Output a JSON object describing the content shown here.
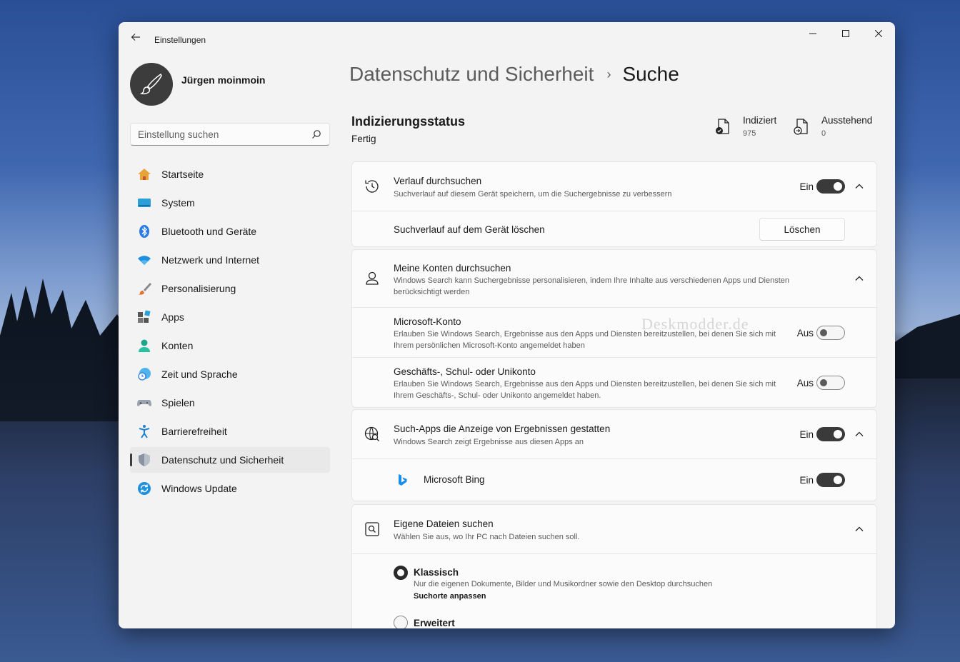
{
  "window": {
    "title": "Einstellungen",
    "controls": {
      "minimize": "—",
      "maximize": "☐",
      "close": "✕"
    }
  },
  "user": {
    "name": "Jürgen moinmoin"
  },
  "search": {
    "placeholder": "Einstellung suchen"
  },
  "sidebar": {
    "items": [
      {
        "label": "Startseite",
        "icon": "home-icon"
      },
      {
        "label": "System",
        "icon": "system-icon"
      },
      {
        "label": "Bluetooth und Geräte",
        "icon": "bluetooth-icon"
      },
      {
        "label": "Netzwerk und Internet",
        "icon": "wifi-icon"
      },
      {
        "label": "Personalisierung",
        "icon": "brush-icon"
      },
      {
        "label": "Apps",
        "icon": "apps-icon"
      },
      {
        "label": "Konten",
        "icon": "accounts-icon"
      },
      {
        "label": "Zeit und Sprache",
        "icon": "time-language-icon"
      },
      {
        "label": "Spielen",
        "icon": "gamepad-icon"
      },
      {
        "label": "Barrierefreiheit",
        "icon": "accessibility-icon"
      },
      {
        "label": "Datenschutz und Sicherheit",
        "icon": "shield-icon",
        "active": true
      },
      {
        "label": "Windows Update",
        "icon": "update-icon"
      }
    ]
  },
  "breadcrumb": {
    "parent": "Datenschutz und Sicherheit",
    "separator": "›",
    "current": "Suche"
  },
  "indexing": {
    "title": "Indizierungsstatus",
    "status": "Fertig",
    "indexed": {
      "label": "Indiziert",
      "value": "975"
    },
    "pending": {
      "label": "Ausstehend",
      "value": "0"
    }
  },
  "history": {
    "title": "Verlauf durchsuchen",
    "desc": "Suchverlauf auf diesem Gerät speichern, um die Suchergebnisse zu verbessern",
    "state": "Ein",
    "clear_label": "Suchverlauf auf dem Gerät löschen",
    "clear_button": "Löschen"
  },
  "accounts": {
    "title": "Meine Konten durchsuchen",
    "desc": "Windows Search kann Suchergebnisse personalisieren, indem Ihre Inhalte aus verschiedenen Apps und Diensten berücksichtigt werden",
    "microsoft": {
      "title": "Microsoft-Konto",
      "desc": "Erlauben Sie Windows Search, Ergebnisse aus den Apps und Diensten bereitzustellen, bei denen Sie sich mit Ihrem persönlichen Microsoft-Konto angemeldet haben",
      "state": "Aus"
    },
    "work": {
      "title": "Geschäfts-, Schul- oder Unikonto",
      "desc": "Erlauben Sie Windows Search, Ergebnisse aus den Apps und Diensten bereitzustellen, bei denen Sie sich mit Ihrem Geschäfts-, Schul- oder Unikonto angemeldet haben.",
      "state": "Aus"
    }
  },
  "search_apps": {
    "title": "Such-Apps die Anzeige von Ergebnissen gestatten",
    "desc": "Windows Search zeigt Ergebnisse aus diesen Apps an",
    "state": "Ein",
    "bing": {
      "label": "Microsoft Bing",
      "state": "Ein"
    }
  },
  "files": {
    "title": "Eigene Dateien suchen",
    "desc": "Wählen Sie aus, wo Ihr PC nach Dateien suchen soll.",
    "classic": {
      "title": "Klassisch",
      "desc": "Nur die eigenen Dokumente, Bilder und Musikordner sowie den Desktop durchsuchen",
      "link": "Suchorte anpassen"
    },
    "enhanced": {
      "title": "Erweitert"
    }
  },
  "watermark": "Deskmodder.de",
  "colors": {
    "accent": "#3a3a3a",
    "window_bg": "#f3f3f3",
    "card_bg": "#fbfbfb"
  }
}
